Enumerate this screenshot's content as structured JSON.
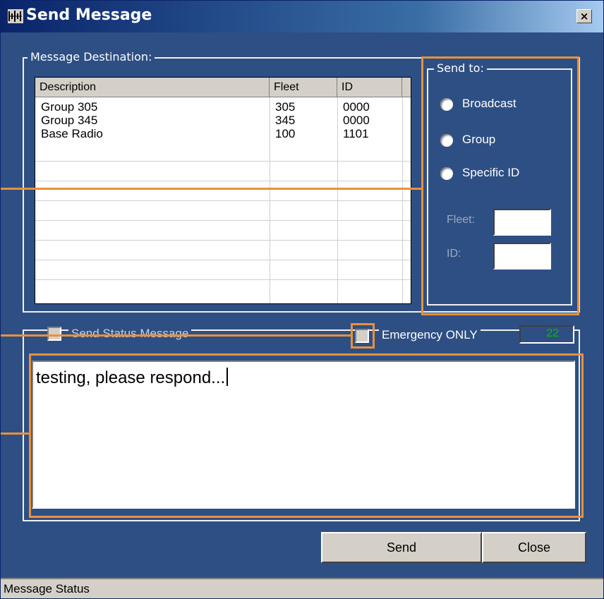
{
  "window": {
    "title": "Send Message",
    "close_label": "×"
  },
  "destination": {
    "legend": "Message Destination:",
    "columns": [
      "Description",
      "Fleet",
      "ID"
    ],
    "rows": [
      [
        "Group 305",
        "305",
        "0000"
      ],
      [
        "Group 345",
        "345",
        "0000"
      ],
      [
        "Base Radio",
        "100",
        "1101"
      ]
    ]
  },
  "send_to": {
    "legend": "Send to:",
    "options": [
      "Broadcast",
      "Group",
      "Specific ID"
    ],
    "fleet_label": "Fleet:",
    "id_label": "ID:",
    "fleet_value": "",
    "id_value": ""
  },
  "options": {
    "send_status_label": "Send Status Message",
    "emergency_label": "Emergency ONLY",
    "char_count": "22"
  },
  "message": {
    "text": "testing, please respond..."
  },
  "buttons": {
    "send": "Send",
    "close": "Close"
  },
  "status": {
    "text": "Message Status"
  },
  "colors": {
    "window_bg": "#2e4f84",
    "annotation": "#e8913b",
    "counter_text": "#00c000"
  }
}
